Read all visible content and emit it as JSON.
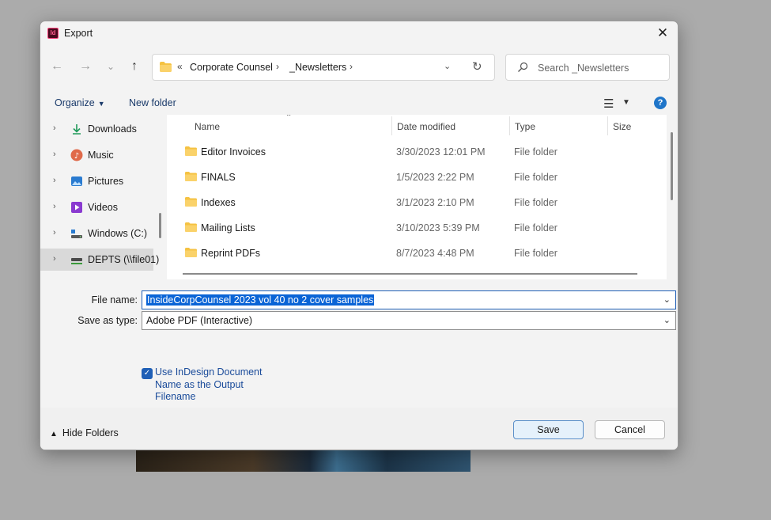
{
  "window": {
    "title": "Export",
    "app_icon_text": "Id"
  },
  "nav": {
    "back": "←",
    "forward": "→",
    "recent": "⌄",
    "up": "↑"
  },
  "address": {
    "prefix": "«",
    "crumbs": [
      "Corporate Counsel",
      "_Newsletters"
    ],
    "separator": "›"
  },
  "search": {
    "placeholder": "Search _Newsletters"
  },
  "toolbar": {
    "organize": "Organize",
    "new_folder": "New folder"
  },
  "sidebar": {
    "items": [
      {
        "label": "Downloads",
        "icon": "download-icon",
        "color": "#1f9a5a"
      },
      {
        "label": "Music",
        "icon": "music-icon",
        "color": "#e06a4a"
      },
      {
        "label": "Pictures",
        "icon": "pictures-icon",
        "color": "#2a7bd0"
      },
      {
        "label": "Videos",
        "icon": "videos-icon",
        "color": "#8a3ad0"
      },
      {
        "label": "Windows (C:)",
        "icon": "drive-icon",
        "color": "#4a4a4a"
      },
      {
        "label": "DEPTS (\\\\file01)",
        "icon": "network-drive-icon",
        "color": "#3a9a3a"
      }
    ]
  },
  "columns": {
    "name": "Name",
    "date": "Date modified",
    "type": "Type",
    "size": "Size"
  },
  "files": [
    {
      "name": "Editor Invoices",
      "date": "3/30/2023 12:01 PM",
      "type": "File folder"
    },
    {
      "name": "FINALS",
      "date": "1/5/2023 2:22 PM",
      "type": "File folder"
    },
    {
      "name": "Indexes",
      "date": "3/1/2023 2:10 PM",
      "type": "File folder"
    },
    {
      "name": "Mailing Lists",
      "date": "3/10/2023 5:39 PM",
      "type": "File folder"
    },
    {
      "name": "Reprint PDFs",
      "date": "8/7/2023 4:48 PM",
      "type": "File folder"
    }
  ],
  "form": {
    "file_name_label": "File name:",
    "file_name_value": "InsideCorpCounsel  2023 vol 40 no 2 cover samples",
    "save_type_label": "Save as type:",
    "save_type_value": "Adobe PDF (Interactive)",
    "checkbox_label": "Use InDesign Document Name as the Output Filename",
    "checkbox_checked": true
  },
  "footer": {
    "hide_folders": "Hide Folders",
    "save": "Save",
    "cancel": "Cancel"
  },
  "colors": {
    "accent": "#1f5fb6",
    "selection": "#0a64d6",
    "folder": "#f5c242"
  }
}
